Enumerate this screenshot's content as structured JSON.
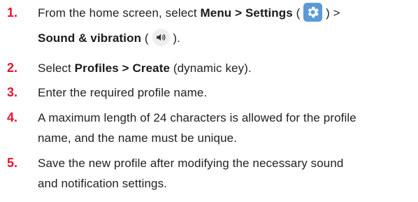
{
  "steps": [
    {
      "number": "1.",
      "line1_pre": "From the home screen, select ",
      "line1_bold": "Menu > Settings",
      "line1_open": " (",
      "settings_icon": "gear-icon",
      "line1_close": ") >",
      "line2_bold": "Sound & vibration",
      "line2_open": " (",
      "sound_icon": "speaker-icon",
      "line2_close": ")."
    },
    {
      "number": "2.",
      "pre": "Select ",
      "bold": "Profiles > Create",
      "post": " (dynamic key)."
    },
    {
      "number": "3.",
      "text": "Enter the required profile name."
    },
    {
      "number": "4.",
      "line1": "A maximum length of 24 characters is allowed for the profile",
      "line2": "name, and the name must be unique."
    },
    {
      "number": "5.",
      "line1": "Save the new profile after modifying the necessary sound",
      "line2": "and notification settings."
    }
  ],
  "colors": {
    "step_number": "#e8112d",
    "settings_icon_bg": "#5b9ad8",
    "sound_icon_bg": "#eeeeee"
  }
}
